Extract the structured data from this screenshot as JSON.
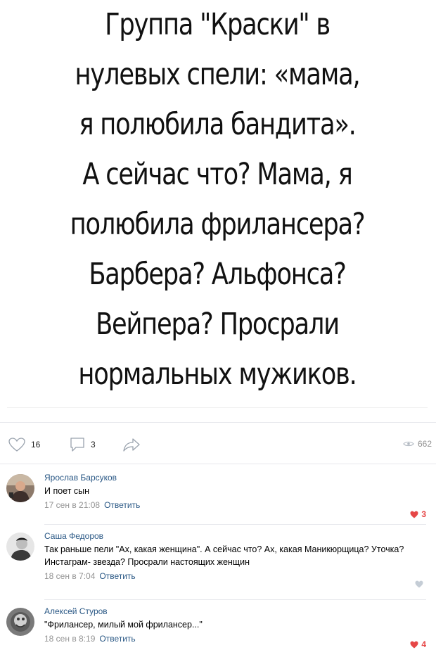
{
  "meme": {
    "lines": [
      "Группа \"Краски\" в",
      "нулевых спели: «мама,",
      "я полюбила бандита».",
      "А сейчас что? Мама, я",
      "полюбила фрилансера?",
      "Барбера? Альфонса?",
      "Вейпера? Просрали",
      "нормальных мужиков."
    ]
  },
  "actions": {
    "likes": "16",
    "comments": "3",
    "views": "662"
  },
  "comments": [
    {
      "author": "Ярослав Барсуков",
      "text": "И поет сын",
      "date": "17 сен в 21:08",
      "reply": "Ответить",
      "likes": "3",
      "liked": true
    },
    {
      "author": "Саша Федоров",
      "text": "Так раньше пели \"Ах, какая женщина\". А сейчас что? Ах, какая Маникюрщица? Уточка? Инстаграм- звезда? Просрали настоящих женщин",
      "date": "18 сен в 7:04",
      "reply": "Ответить",
      "likes": "",
      "liked": false
    },
    {
      "author": "Алексей Стуров",
      "text": "\"Фрилансер, милый мой фрилансер...\"",
      "date": "18 сен в 8:19",
      "reply": "Ответить",
      "likes": "4",
      "liked": true
    }
  ],
  "colors": {
    "link": "#2a5885",
    "meta": "#939393",
    "like_active": "#e64646",
    "divider": "#e7e8ec"
  }
}
